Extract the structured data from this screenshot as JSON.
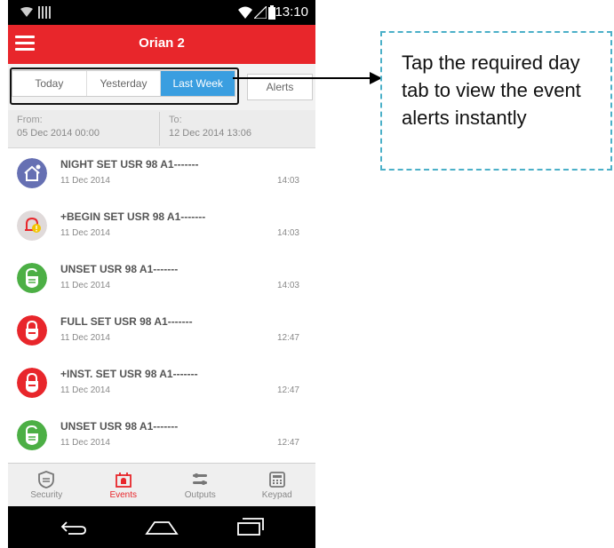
{
  "status_bar": {
    "time": "13:10"
  },
  "app_bar": {
    "title": "Orian 2"
  },
  "tabs": {
    "day_tabs": [
      {
        "label": "Today",
        "active": false
      },
      {
        "label": "Yesterday",
        "active": false
      },
      {
        "label": "Last Week",
        "active": true
      }
    ],
    "alerts_label": "Alerts",
    "active_color": "#3a9ee0"
  },
  "date_range": {
    "from_label": "From:",
    "from_value": "05 Dec 2014  00:00",
    "to_label": "To:",
    "to_value": "12 Dec 2014  13:06"
  },
  "events": [
    {
      "title": "NIGHT SET USR 98 A1-------",
      "date": "11 Dec 2014",
      "time": "14:03",
      "icon": "house-night-icon",
      "color": "#6670b3"
    },
    {
      "title": "+BEGIN SET USR 98 A1-------",
      "date": "11 Dec 2014",
      "time": "14:03",
      "icon": "bell-alert-icon",
      "color": "#e0dada"
    },
    {
      "title": "UNSET USR 98 A1-------",
      "date": "11 Dec 2014",
      "time": "14:03",
      "icon": "unlock-shield-icon",
      "color": "#4caf45"
    },
    {
      "title": "FULL SET USR 98 A1-------",
      "date": "11 Dec 2014",
      "time": "12:47",
      "icon": "lock-shield-icon",
      "color": "#e8262b"
    },
    {
      "title": "+INST. SET USR 98 A1-------",
      "date": "11 Dec 2014",
      "time": "12:47",
      "icon": "lock-shield-icon",
      "color": "#e8262b"
    },
    {
      "title": "UNSET USR 98 A1-------",
      "date": "11 Dec 2014",
      "time": "12:47",
      "icon": "unlock-shield-icon",
      "color": "#4caf45"
    }
  ],
  "bottom_nav": [
    {
      "label": "Security",
      "icon": "shield-icon",
      "active": false
    },
    {
      "label": "Events",
      "icon": "event-bell-icon",
      "active": true
    },
    {
      "label": "Outputs",
      "icon": "sliders-icon",
      "active": false
    },
    {
      "label": "Keypad",
      "icon": "keypad-icon",
      "active": false
    }
  ],
  "callout": {
    "text": "Tap the required day tab to view the event alerts instantly"
  }
}
